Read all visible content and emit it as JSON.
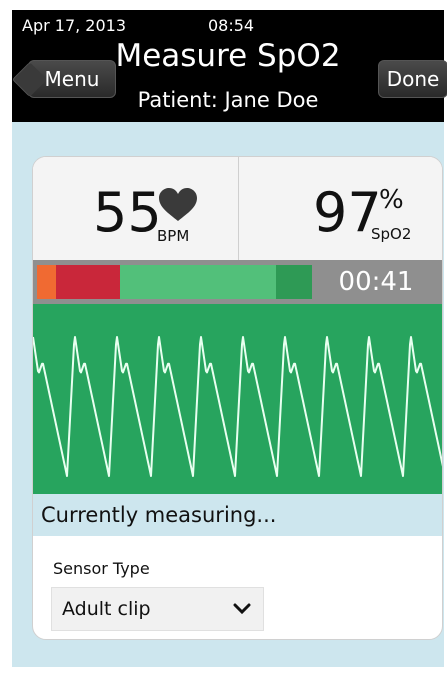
{
  "status": {
    "date": "Apr 17, 2013",
    "time": "08:54"
  },
  "nav": {
    "title": "Measure SpO2",
    "subtitle": "Patient: Jane Doe",
    "menu_label": "Menu",
    "done_label": "Done"
  },
  "readings": {
    "heart_rate": "55",
    "heart_rate_unit": "BPM",
    "spo2": "97",
    "spo2_percent": "%",
    "spo2_unit": "SpO2",
    "heart_icon": "heart-icon"
  },
  "signal_bar": {
    "segments": [
      {
        "color": "#f06a32",
        "fraction": 0.07
      },
      {
        "color": "#c9273a",
        "fraction": 0.23
      },
      {
        "color": "#52c07a",
        "fraction": 0.57
      },
      {
        "color": "#2e9a55",
        "fraction": 0.13
      }
    ],
    "elapsed": "00:41"
  },
  "waveform": {
    "background": "#27a45e",
    "line_color": "#e8fff0"
  },
  "measurement_status": "Currently measuring...",
  "sensor": {
    "label": "Sensor Type",
    "selected": "Adult clip",
    "dropdown_icon": "chevron-down-icon"
  },
  "colors": {
    "header_bg": "#000000",
    "page_bg": "#cde6ee",
    "accent_green": "#27a45e"
  }
}
